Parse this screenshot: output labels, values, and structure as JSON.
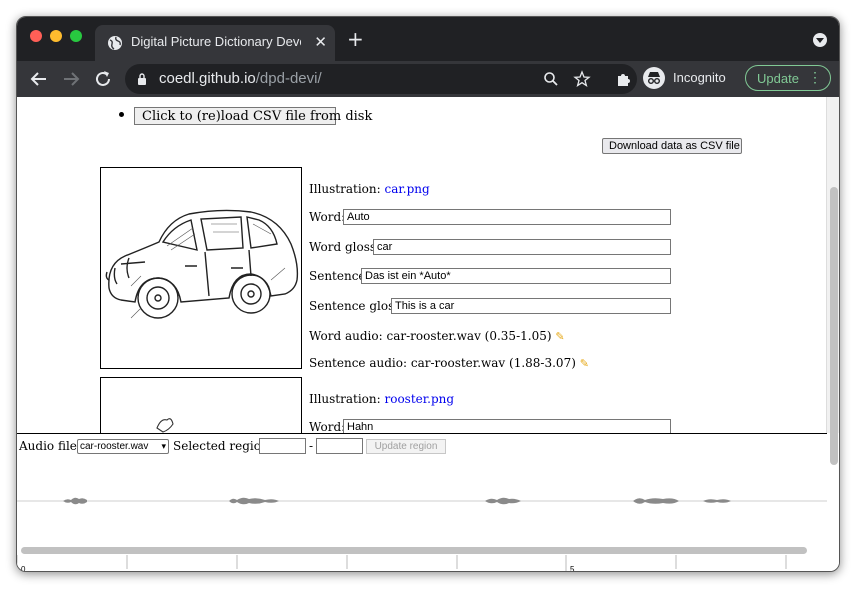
{
  "browser": {
    "tab_title": "Digital Picture Dictionary Devel",
    "url_host": "coedl.github.io",
    "url_path": "/dpd-devi/",
    "incognito_label": "Incognito",
    "update_label": "Update",
    "new_tab_symbol": "+",
    "close_symbol": "✕"
  },
  "page": {
    "reload_button": "Click to (re)load CSV file from disk",
    "download_button": "Download data as CSV file",
    "entries": [
      {
        "illustration_label": "Illustration:",
        "illustration_file": "car.png",
        "word_label": "Word:",
        "word": "Auto",
        "word_gloss_label": "Word gloss:",
        "word_gloss": "car",
        "sentence_label": "Sentence:",
        "sentence": "Das ist ein *Auto*",
        "sentence_gloss_label": "Sentence gloss:",
        "sentence_gloss": "This is a car",
        "word_audio_label": "Word audio:",
        "word_audio": "car-rooster.wav (0.35-1.05)",
        "sentence_audio_label": "Sentence audio:",
        "sentence_audio": "car-rooster.wav (1.88-3.07)"
      },
      {
        "illustration_label": "Illustration:",
        "illustration_file": "rooster.png",
        "word_label": "Word:",
        "word": "Hahn"
      }
    ]
  },
  "audio_panel": {
    "audio_file_label": "Audio file:",
    "audio_file_selected": "car-rooster.wav",
    "selected_region_label": "Selected region:",
    "region_separator": "-",
    "region_start": "",
    "region_end": "",
    "update_region_button": "Update region",
    "timeline_labels": [
      "0",
      "5"
    ]
  },
  "colors": {
    "link": "#0000ee",
    "pencil": "#e6a817",
    "update_accent": "#81c995",
    "chrome_dark": "#202124",
    "chrome_mid": "#35363a"
  },
  "icons": {
    "tab_favicon": "globe-icon",
    "back": "arrow-left-icon",
    "forward": "arrow-right-icon",
    "reload": "reload-icon",
    "lock": "lock-icon",
    "zoom": "magnifier-icon",
    "bookmark": "star-icon",
    "extensions": "puzzle-icon",
    "edit": "pencil-icon"
  }
}
